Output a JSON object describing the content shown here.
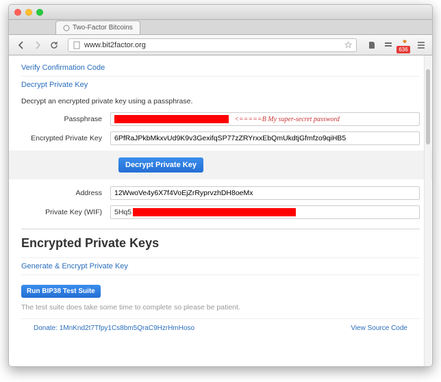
{
  "browser": {
    "tab_title": "Two-Factor Bitcoins",
    "url": "www.bit2factor.org",
    "ext_badge": "636"
  },
  "links": {
    "verify": "Verify Confirmation Code",
    "decrypt": "Decrypt Private Key"
  },
  "decrypt": {
    "description": "Decrypt an encrypted private key using a passphrase.",
    "labels": {
      "passphrase": "Passphrase",
      "encrypted": "Encrypted Private Key",
      "address": "Address",
      "wif": "Private Key (WIF)"
    },
    "annotation": "<=====B My super-secret password",
    "encrypted_value": "6PfRaJPkbMkxvUd9K9v3GexifqSP77zZRYrxxEbQmUkdtjGfmfzo9qiHB5",
    "button": "Decrypt Private Key",
    "address_value": "12WwoVe4y6X7f4VoEjZrRyprvzhDH8oeMx",
    "wif_prefix": "5Hq5"
  },
  "section": {
    "heading": "Encrypted Private Keys",
    "generate_link": "Generate & Encrypt Private Key"
  },
  "testsuite": {
    "button": "Run BIP38 Test Suite",
    "note": "The test suite does take some time to complete so please be patient."
  },
  "footer": {
    "donate": "Donate: 1MnKnd2t7Tfpy1Cs8bm5QraC9HzrHmHoso",
    "source": "View Source Code"
  }
}
